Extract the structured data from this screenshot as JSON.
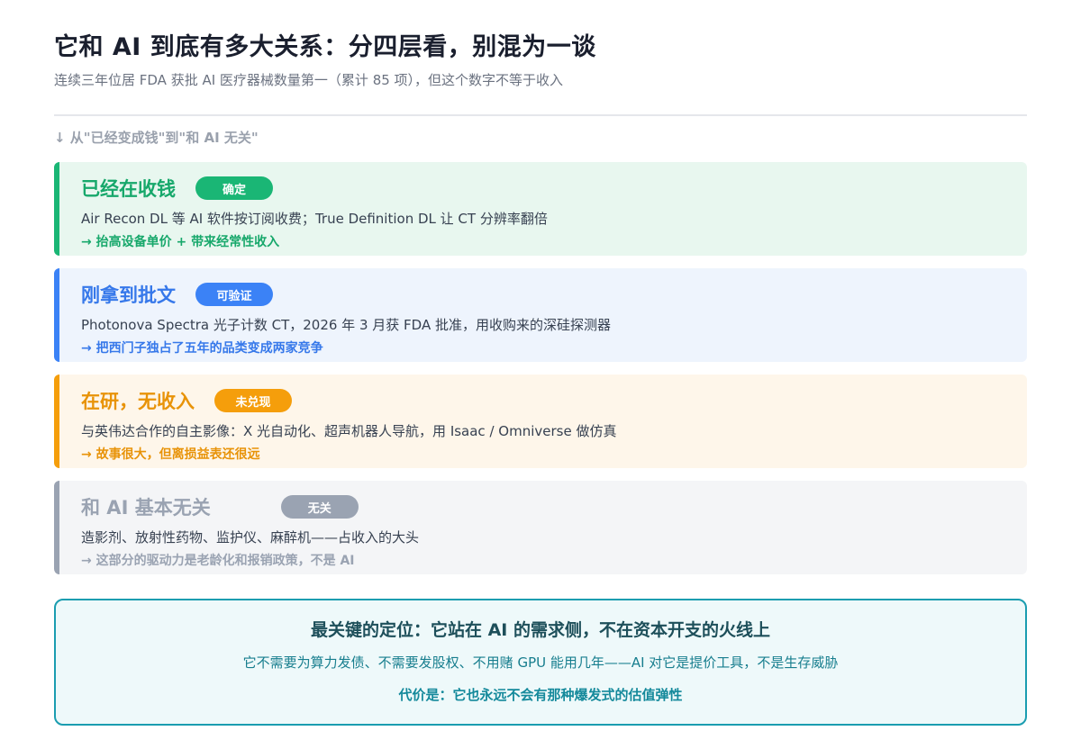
{
  "header": {
    "title": "它和 AI 到底有多大关系：分四层看，别混为一谈",
    "subtitle": "连续三年位居 FDA 获批 AI 医疗器械数量第一（累计 85 项），但这个数字不等于收入",
    "hint": "↓ 从\"已经变成钱\"到\"和 AI 无关\""
  },
  "layers": [
    {
      "name": "已经在收钱",
      "badge": "确定",
      "desc": "Air Recon DL 等 AI 软件按订阅收费；True Definition DL 让 CT 分辨率翻倍",
      "note": "→ 抬高设备单价 + 带来经常性收入",
      "color": "#1ab675"
    },
    {
      "name": "刚拿到批文",
      "badge": "可验证",
      "desc": "Photonova Spectra 光子计数 CT，2026 年 3 月获 FDA 批准，用收购来的深硅探测器",
      "note": "→ 把西门子独占了五年的品类变成两家竞争",
      "color": "#3b82f6"
    },
    {
      "name": "在研，无收入",
      "badge": "未兑现",
      "desc": "与英伟达合作的自主影像：X 光自动化、超声机器人导航，用 Isaac / Omniverse 做仿真",
      "note": "→ 故事很大，但离损益表还很远",
      "color": "#f59e0b"
    },
    {
      "name": "和 AI 基本无关",
      "badge": "无关",
      "desc": "造影剂、放射性药物、监护仪、麻醉机——占收入的大头",
      "note": "→ 这部分的驱动力是老龄化和报销政策，不是 AI",
      "color": "#9aa3b2"
    }
  ],
  "summary": {
    "title": "最关键的定位：它站在 AI 的需求侧，不在资本开支的火线上",
    "body": "它不需要为算力发债、不需要发股权、不用赌 GPU 能用几年——AI 对它是提价工具，不是生存威胁",
    "cost": "代价是：它也永远不会有那种爆发式的估值弹性",
    "color": "#1a9db0"
  }
}
